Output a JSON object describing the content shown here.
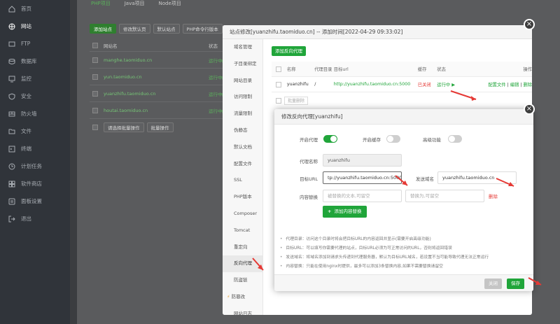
{
  "sidebar": {
    "items": [
      {
        "label": "首页",
        "icon": "home-icon"
      },
      {
        "label": "网站",
        "icon": "globe-icon",
        "active": true
      },
      {
        "label": "FTP",
        "icon": "ftp-icon"
      },
      {
        "label": "数据库",
        "icon": "database-icon"
      },
      {
        "label": "监控",
        "icon": "monitor-icon"
      },
      {
        "label": "安全",
        "icon": "shield-icon"
      },
      {
        "label": "防火墙",
        "icon": "firewall-icon"
      },
      {
        "label": "文件",
        "icon": "folder-icon"
      },
      {
        "label": "终端",
        "icon": "terminal-icon"
      },
      {
        "label": "计划任务",
        "icon": "clock-icon"
      },
      {
        "label": "软件商店",
        "icon": "store-icon"
      },
      {
        "label": "面板设置",
        "icon": "settings-icon"
      },
      {
        "label": "退出",
        "icon": "logout-icon"
      }
    ]
  },
  "background": {
    "tabs": [
      "PHP项目",
      "Java项目",
      "Node项目"
    ],
    "toolbar": [
      "添加站点",
      "修改默认页",
      "默认站点",
      "PHP命令行版本"
    ],
    "table_header": {
      "name": "网站名",
      "status": "状态"
    },
    "sites": [
      {
        "name": "manghe.taomiduo.cn",
        "status": "运行中▶"
      },
      {
        "name": "yun.taomiduo.cn",
        "status": "运行中▶"
      },
      {
        "name": "yuanzhifu.taomiduo.cn",
        "status": "运行中▶"
      },
      {
        "name": "houtai.taomiduo.cn",
        "status": "运行中▶"
      }
    ],
    "bulk_select": "请选择批量操作",
    "bulk_button": "批量操作"
  },
  "site_dialog": {
    "title": "站点修改[yuanzhifu.taomiduo.cn] -- 添加时间[2022-04-29 09:33:02]",
    "menu": [
      "域名管理",
      "子目录绑定",
      "网站目录",
      "访问限制",
      "流量限制",
      "伪静态",
      "默认文档",
      "配置文件",
      "SSL",
      "PHP版本",
      "Composer",
      "Tomcat",
      "重定向",
      "反向代理",
      "防盗链",
      "防篡改",
      "网站日志"
    ],
    "add_proxy": "添加反向代理",
    "columns": {
      "name": "名称",
      "dir": "代理目录",
      "url": "目标url",
      "cache": "缓存",
      "state": "状态",
      "op": "操作"
    },
    "row": {
      "name": "yuanzhifu",
      "dir": "/",
      "url": "http://yuanzhifu.taomiduo.cn:5000",
      "cache": "已关闭",
      "state": "运行中 ▶",
      "op_config": "配置文件",
      "op_edit": "编辑",
      "op_delete": "删除"
    },
    "bulk_delete": "批量删除"
  },
  "proxy_dialog": {
    "title": "修改反向代理[yuanzhifu]",
    "enable_label": "开启代理",
    "cache_label": "开启缓存",
    "advanced_label": "高级功能",
    "name_label": "代理名称",
    "name_value": "yuanzhifu",
    "target_label": "目标URL",
    "target_value": "tp://yuanzhifu.taomiduo.cn:5000",
    "send_domain_label": "发送域名",
    "send_domain_value": "yuanzhifu.taomiduo.cn",
    "replace_label": "内容替换",
    "replace_from_placeholder": "被替换的文本,可留空",
    "replace_to_placeholder": "替换为,可留空",
    "delete_link": "删除",
    "add_replace": "添加内容替换",
    "add_replace_icon": "plus-icon",
    "notes": [
      "代理目录：访问这个目录时将会把目标URL的内容返回并显示(需要开启高级功能)",
      "目标URL：可以填写你需要代理的站点，目标URL必须为可正常访问的URL，否则将返回错误",
      "发送域名：将域名添加到请求头传递到代理服务器，默认为目标URL域名，若设置不当可能导致代理无法正常运行",
      "内容替换：只能在使用nginx时提供，最多可以添加3条替换内容,如果不需要替换请留空"
    ],
    "close_button": "关闭",
    "save_button": "保存"
  },
  "colors": {
    "accent": "#20a53a",
    "danger": "#e53935",
    "sidebar_bg": "#30343a"
  }
}
